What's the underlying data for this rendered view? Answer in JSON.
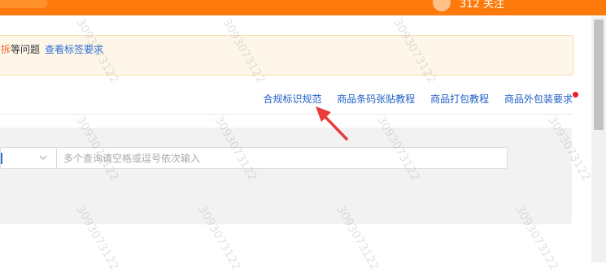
{
  "header": {
    "user_text": "312 关注"
  },
  "notice": {
    "highlight": "拆",
    "text": "等问题",
    "link": "查看标签要求"
  },
  "links": [
    "合规标识规范",
    "商品条码张贴教程",
    "商品打包教程",
    "商品外包装要求"
  ],
  "search": {
    "placeholder": "多个查询请空格或逗号依次输入"
  },
  "watermark": "3093073122",
  "colors": {
    "brand_orange": "#fd7a0b",
    "link_blue": "#1f5fc4",
    "notice_bg": "#fdf6e9",
    "arrow_red": "#ea3c3c",
    "dot_red": "#f01c2c"
  },
  "icons": {
    "select_arrow": "chevron-down-icon",
    "annotation": "red-arrow-icon",
    "notification": "red-dot"
  }
}
